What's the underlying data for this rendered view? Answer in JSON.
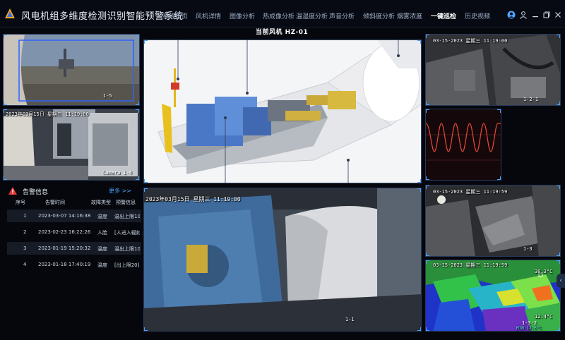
{
  "app": {
    "title": "风电机组多维度检测识别智能预警系统"
  },
  "nav": {
    "items": [
      {
        "label": "系统首页",
        "active": false
      },
      {
        "label": "风机详情",
        "active": false
      },
      {
        "label": "图像分析",
        "active": false
      },
      {
        "label": "热成像分析",
        "active": false
      },
      {
        "label": "温湿度分析",
        "active": false
      },
      {
        "label": "声音分析",
        "active": false
      },
      {
        "label": "倾斜度分析",
        "active": false
      },
      {
        "label": "烟雾浓度",
        "active": false
      },
      {
        "label": "一键巡检",
        "active": true
      },
      {
        "label": "历史视频",
        "active": false
      }
    ]
  },
  "header_icons": [
    "user-circle-icon",
    "user-icon",
    "minimize-icon",
    "restore-icon",
    "close-icon"
  ],
  "main": {
    "title": "当前风机   HZ-01"
  },
  "cameras": {
    "cam_1_5": {
      "label": "1-5"
    },
    "cam_1_4": {
      "osd": "2023年03月15日 星期三 11:19:00",
      "label": "Camera 1-4"
    },
    "main_feed": {
      "osd": "2023年03月15日  星期三  11:19:00",
      "label": "1-1"
    },
    "cam_1_2_1": {
      "osd": "03-15-2023 星期三 11:19:00",
      "label": "1-2-1"
    },
    "cam_1_3": {
      "osd": "03-15-2023 星期三 11:19:59",
      "label": "1-3"
    },
    "thermal": {
      "osd": "03-15-2023 星期三 11:19:59",
      "max_temp": "30.3°C",
      "min_temp": "12.4°C",
      "min_temp_readout": "MIN:12.6°C",
      "label": "1-3-2"
    }
  },
  "alerts": {
    "title": "告警信息",
    "more_label": "更多 >>",
    "columns": [
      "序号",
      "告警时间",
      "故障类型",
      "预警信息"
    ],
    "rows": [
      {
        "no": "1",
        "time": "2023-03-07 14:16:38",
        "type": "温度",
        "info": "温出上限10"
      },
      {
        "no": "2",
        "time": "2023-02-23 16:22:26",
        "type": "人脸",
        "info": "[人进入辐射"
      },
      {
        "no": "3",
        "time": "2023-01-19 15:20:32",
        "type": "温度",
        "info": "温出上限10"
      },
      {
        "no": "4",
        "time": "2023-01-18 17:40:19",
        "type": "温度",
        "info": "[出上限20]"
      }
    ]
  },
  "side_tab": {
    "label": "‹"
  },
  "colors": {
    "accent": "#4da3ff",
    "alert": "#e53935",
    "background": "#05070c"
  }
}
